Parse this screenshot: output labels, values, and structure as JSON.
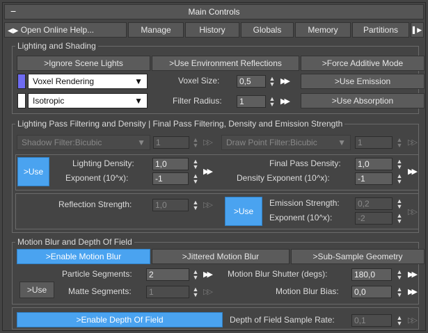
{
  "header": {
    "title": "Main Controls",
    "collapse": "−"
  },
  "tabs": [
    "Open Online Help...",
    "Manage",
    "History",
    "Globals",
    "Memory",
    "Partitions"
  ],
  "lighting": {
    "title": "Lighting and Shading",
    "ignore_lights": ">Ignore Scene Lights",
    "env_reflections": ">Use Environment Reflections",
    "additive": ">Force Additive Mode",
    "render_mode": "Voxel Rendering",
    "shading_mode": "Isotropic",
    "voxel_size_label": "Voxel Size:",
    "voxel_size": "0,5",
    "filter_radius_label": "Filter Radius:",
    "filter_radius": "1",
    "use_emission": ">Use Emission",
    "use_absorption": ">Use Absorption",
    "colors": {
      "voxel_swatch": "#6f6cf2",
      "iso_swatch": "#ffffff"
    }
  },
  "filtering": {
    "title": "Lighting Pass Filtering and Density | Final Pass Filtering, Density and Emission Strength",
    "shadow_filter": "Shadow Filter:Bicubic",
    "shadow_value": "1",
    "point_filter": "Draw Point Filter:Bicubic",
    "point_value": "1",
    "use_label": ">Use",
    "lighting_density_label": "Lighting Density:",
    "lighting_density": "1,0",
    "exponent_label": "Exponent (10^x):",
    "exponent": "-1",
    "final_density_label": "Final Pass Density:",
    "final_density": "1,0",
    "density_exp_label": "Density Exponent (10^x):",
    "density_exp": "-1",
    "reflection_label": "Reflection Strength:",
    "reflection": "1,0",
    "use2_label": ">Use",
    "emission_label": "Emission Strength:",
    "emission": "0,2",
    "emission_exp_label": "Exponent (10^x):",
    "emission_exp": "-2"
  },
  "motion": {
    "title": "Motion Blur and Depth Of Field",
    "enable_mb": ">Enable Motion Blur",
    "jittered": ">Jittered Motion Blur",
    "subsample": ">Sub-Sample Geometry",
    "particle_seg_label": "Particle Segments:",
    "particle_seg": "2",
    "shutter_label": "Motion Blur Shutter (degs):",
    "shutter": "180,0",
    "use_label": ">Use",
    "matte_seg_label": "Matte Segments:",
    "matte_seg": "1",
    "bias_label": "Motion Blur Bias:",
    "bias": "0,0",
    "enable_dof": ">Enable Depth Of Field",
    "dof_rate_label": "Depth of Field Sample Rate:",
    "dof_rate": "0,1"
  }
}
